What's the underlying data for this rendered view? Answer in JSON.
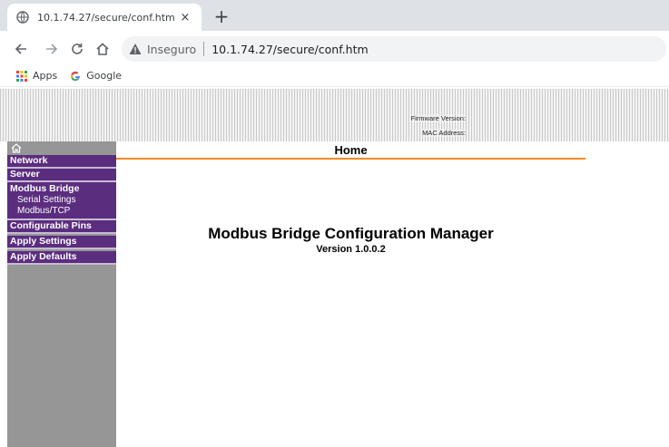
{
  "browser": {
    "tab_title": "10.1.74.27/secure/conf.htm",
    "tab_close": "×",
    "new_tab": "+",
    "security_label": "Inseguro",
    "url": "10.1.74.27/secure/conf.htm",
    "bookmarks": [
      {
        "label": "Apps",
        "icon": "apps-grid-icon"
      },
      {
        "label": "Google",
        "icon": "google-icon"
      }
    ]
  },
  "header": {
    "firmware_label": "Firmware Version:",
    "mac_label": "MAC Address:"
  },
  "sidebar": {
    "home_icon": "home-icon",
    "items": {
      "network": "Network",
      "server": "Server",
      "modbus_bridge": "Modbus Bridge",
      "serial_settings": "Serial Settings",
      "modbus_tcp": "Modbus/TCP",
      "configurable_pins": "Configurable Pins",
      "apply_settings": "Apply Settings",
      "apply_defaults": "Apply Defaults"
    }
  },
  "main": {
    "page_title": "Home",
    "app_title": "Modbus Bridge Configuration Manager",
    "version": "Version 1.0.0.2"
  },
  "colors": {
    "menu_purple": "#5b2d7f",
    "sidebar_gray": "#969696",
    "title_rule_orange": "#f08a24"
  }
}
